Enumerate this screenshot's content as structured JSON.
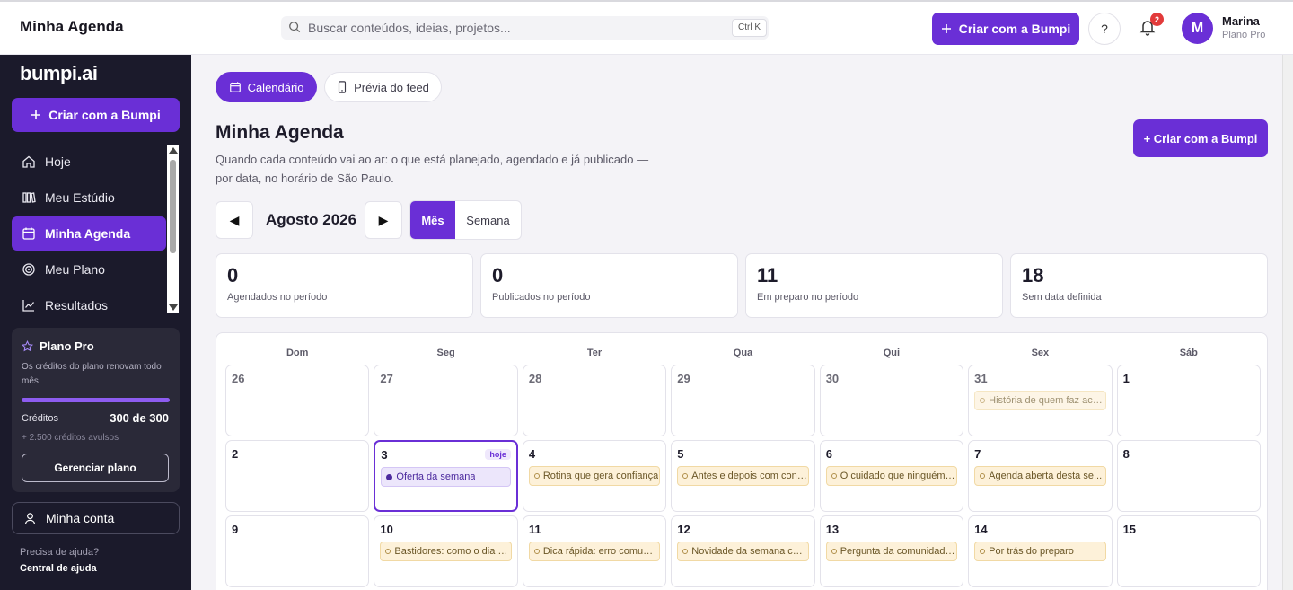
{
  "topbar": {
    "title": "Minha Agenda",
    "search_placeholder": "Buscar conteúdos, ideias, projetos...",
    "search_shortcut": "Ctrl K",
    "cta_label": "Criar com a Bumpi",
    "help_label": "?",
    "notifications_count": "2",
    "user_initial": "M",
    "user_name": "Marina",
    "user_plan": "Plano Pro"
  },
  "sidebar": {
    "brand": "bumpi.ai",
    "cta_label": "Criar com a Bumpi",
    "items": [
      {
        "label": "Hoje",
        "icon": "home-icon"
      },
      {
        "label": "Meu Estúdio",
        "icon": "studio-icon"
      },
      {
        "label": "Minha Agenda",
        "icon": "calendar-icon",
        "active": true
      },
      {
        "label": "Meu Plano",
        "icon": "target-icon"
      },
      {
        "label": "Resultados",
        "icon": "chart-icon"
      }
    ],
    "plan": {
      "title": "Plano Pro",
      "description": "Os créditos do plano renovam todo mês",
      "credits_label": "Créditos",
      "credits_value": "300 de 300",
      "credits_fraction": 1.0,
      "extra": "+ 2.500 créditos avulsos",
      "manage_label": "Gerenciar plano"
    },
    "account_label": "Minha conta",
    "help_question": "Precisa de ajuda?",
    "help_link": "Central de ajuda"
  },
  "main": {
    "tabs": [
      {
        "label": "Calendário",
        "active": true
      },
      {
        "label": "Prévia do feed",
        "active": false
      }
    ],
    "title": "Minha Agenda",
    "subtitle": "Quando cada conteúdo vai ao ar: o que está planejado, agendado e já publicado — por data, no horário de São Paulo.",
    "cta_label": "+ Criar com a Bumpi",
    "month_label": "Agosto 2026",
    "prev_label": "◀",
    "next_label": "▶",
    "view_month": "Mês",
    "view_week": "Semana",
    "stats": [
      {
        "value": "0",
        "label": "Agendados no período"
      },
      {
        "value": "0",
        "label": "Publicados no período"
      },
      {
        "value": "11",
        "label": "Em preparo no período"
      },
      {
        "value": "18",
        "label": "Sem data definida"
      }
    ],
    "weekdays": [
      "Dom",
      "Seg",
      "Ter",
      "Qua",
      "Qui",
      "Sex",
      "Sáb"
    ],
    "today_badge": "hoje",
    "days": [
      {
        "n": "26",
        "muted": true
      },
      {
        "n": "27",
        "muted": true
      },
      {
        "n": "28",
        "muted": true
      },
      {
        "n": "29",
        "muted": true
      },
      {
        "n": "30",
        "muted": true
      },
      {
        "n": "31",
        "muted": true,
        "event": "História de quem faz aco..."
      },
      {
        "n": "1"
      },
      {
        "n": "2"
      },
      {
        "n": "3",
        "today": true,
        "event": "Oferta da semana",
        "event_style": "purple"
      },
      {
        "n": "4",
        "event": "Rotina que gera confiança"
      },
      {
        "n": "5",
        "event": "Antes e depois com cont..."
      },
      {
        "n": "6",
        "event": "O cuidado que ninguém vê"
      },
      {
        "n": "7",
        "event": "Agenda aberta desta se..."
      },
      {
        "n": "8"
      },
      {
        "n": "9"
      },
      {
        "n": "10",
        "event": "Bastidores: como o dia co..."
      },
      {
        "n": "11",
        "event": "Dica rápida: erro comum ..."
      },
      {
        "n": "12",
        "event": "Novidade da semana che..."
      },
      {
        "n": "13",
        "event": "Pergunta da comunidade..."
      },
      {
        "n": "14",
        "event": "Por trás do preparo"
      },
      {
        "n": "15"
      }
    ]
  },
  "colors": {
    "accent": "#6a2fd6",
    "sidebar_bg": "#1b1a2b",
    "event_bg": "#fdf1d9",
    "badge_red": "#e23a3a"
  }
}
